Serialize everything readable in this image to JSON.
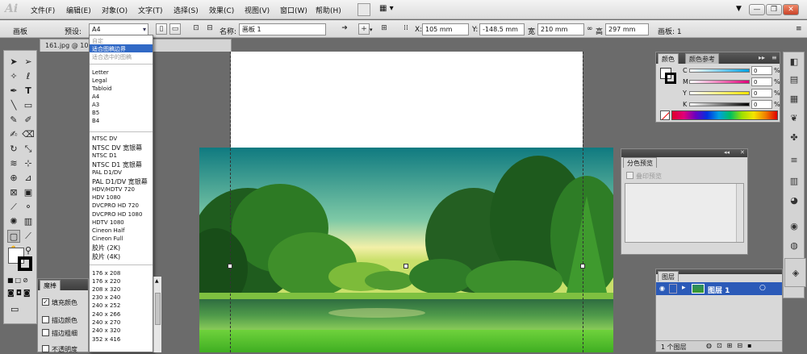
{
  "app": {
    "logo": "Ai"
  },
  "menu": [
    {
      "label": "文件(F)"
    },
    {
      "label": "编辑(E)"
    },
    {
      "label": "对象(O)"
    },
    {
      "label": "文字(T)"
    },
    {
      "label": "选择(S)"
    },
    {
      "label": "效果(C)"
    },
    {
      "label": "视图(V)"
    },
    {
      "label": "窗口(W)"
    },
    {
      "label": "帮助(H)"
    }
  ],
  "window_controls": {
    "minimize": "—",
    "restore": "❐",
    "close": "✕"
  },
  "controlbar": {
    "panel_label": "画板",
    "preset_label": "预设:",
    "preset_value": "A4",
    "name_label": "名称:",
    "name_value": "画板 1",
    "x_label": "X:",
    "x_value": "105 mm",
    "y_label": "Y:",
    "y_value": "-148.5 mm",
    "w_label": "宽",
    "w_value": "210 mm",
    "h_label": "高",
    "h_value": "297 mm",
    "artboard_count": "画板: 1"
  },
  "doc_tab": {
    "title": "161.jpg @ 10"
  },
  "dropdown": {
    "items": [
      "自定",
      "适合图稿边界",
      "适合选中的图稿",
      "Letter",
      "Legal",
      "Tabloid",
      "A4",
      "A3",
      "B5",
      "B4",
      "NTSC DV",
      "NTSC DV 宽银幕",
      "NTSC D1",
      "NTSC D1 宽银幕",
      "PAL D1/DV",
      "PAL D1/DV 宽银幕",
      "HDV/HDTV 720",
      "HDV 1080",
      "DVCPRO HD 720",
      "DVCPRO HD 1080",
      "HDTV 1080",
      "Cineon Half",
      "Cineon Full",
      "胶片 (2K)",
      "胶片 (4K)",
      "176 x 208",
      "176 x 220",
      "208 x 320",
      "230 x 240",
      "240 x 252",
      "240 x 266",
      "240 x 270",
      "240 x 320",
      "352 x 416"
    ],
    "selected": "适合图稿边界"
  },
  "color_panel": {
    "tab_active": "颜色",
    "tab_inactive": "颜色参考",
    "channels": [
      {
        "label": "C",
        "value": "0",
        "unit": "%"
      },
      {
        "label": "M",
        "value": "0",
        "unit": "%"
      },
      {
        "label": "Y",
        "value": "0",
        "unit": "%"
      },
      {
        "label": "K",
        "value": "0",
        "unit": "%"
      }
    ]
  },
  "separations_panel": {
    "title": "分色预览",
    "overprint_label": "叠印预览"
  },
  "layers_panel": {
    "title": "图层",
    "layer_name": "图层 1",
    "footer": "1 个图层"
  },
  "magic_wand_panel": {
    "title": "魔棒",
    "fill_color": "填充颜色",
    "stroke_color": "描边颜色",
    "stroke_weight": "描边粗细",
    "opacity": "不透明度"
  }
}
